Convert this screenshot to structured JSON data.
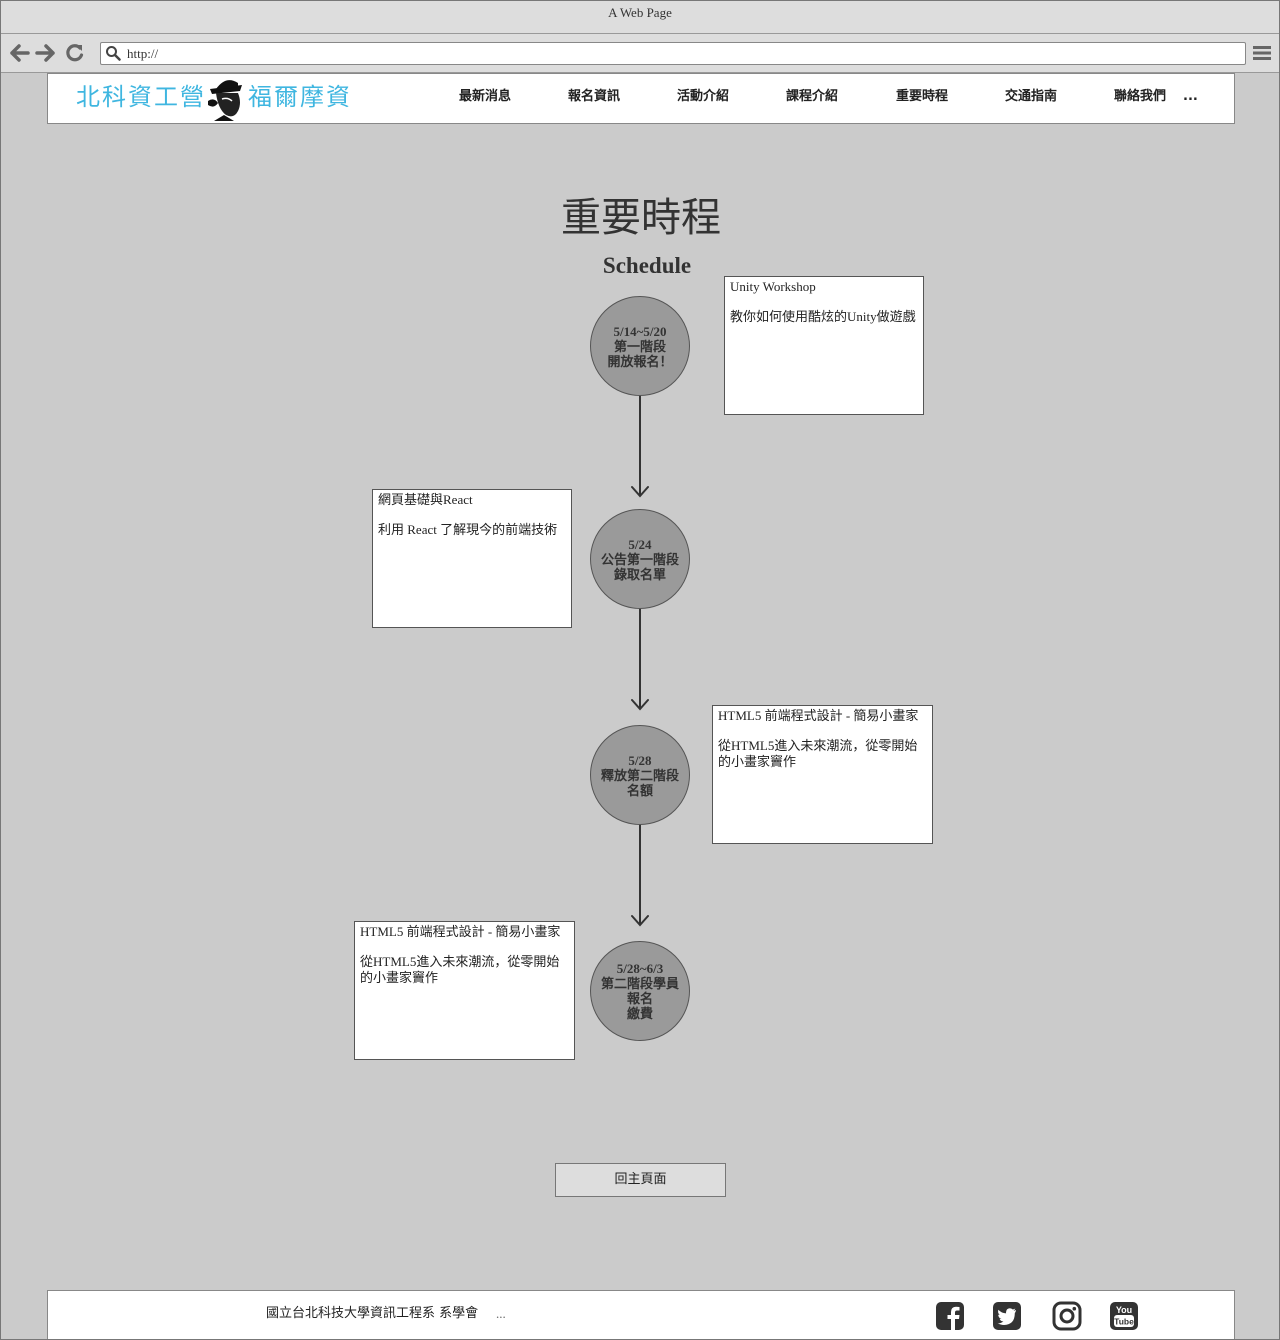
{
  "browser": {
    "window_title": "A Web Page",
    "url": "http://"
  },
  "header": {
    "logo": {
      "left_text": "北科資工營",
      "right_text": "福爾摩資"
    },
    "nav": [
      {
        "label": "最新消息"
      },
      {
        "label": "報名資訊"
      },
      {
        "label": "活動介紹"
      },
      {
        "label": "課程介紹"
      },
      {
        "label": "重要時程"
      },
      {
        "label": "交通指南"
      },
      {
        "label": "聯絡我們"
      },
      {
        "label": "..."
      }
    ]
  },
  "main": {
    "title": "重要時程",
    "subtitle": "Schedule",
    "milestones": [
      {
        "lines": [
          "5/14~5/20",
          "第一階段",
          "開放報名！"
        ]
      },
      {
        "lines": [
          "5/24",
          "公告第一階段",
          "錄取名單"
        ]
      },
      {
        "lines": [
          "5/28",
          "釋放第二階段",
          "名額"
        ]
      },
      {
        "lines": [
          "5/28~6/3",
          "第二階段學員",
          "報名",
          "繳費"
        ]
      }
    ],
    "cards": [
      {
        "title": "Unity Workshop",
        "desc": "教你如何使用酷炫的Unity做遊戲"
      },
      {
        "title": "網頁基礎與React",
        "desc": "利用 React 了解現今的前端技術"
      },
      {
        "title": "HTML5 前端程式設計 - 簡易小畫家",
        "desc": "從HTML5進入未來潮流，從零開始的小畫家竇作"
      },
      {
        "title": "HTML5 前端程式設計 - 簡易小畫家",
        "desc": "從HTML5進入未來潮流，從零開始的小畫家竇作"
      }
    ],
    "back_button": "回主頁面"
  },
  "footer": {
    "org_text": "國立台北科技大學資訊工程系 系學會",
    "more": "...",
    "social_icons": [
      "facebook-icon",
      "twitter-icon",
      "instagram-icon",
      "youtube-icon"
    ],
    "youtube_text_top": "You",
    "youtube_text_bottom": "Tube"
  }
}
